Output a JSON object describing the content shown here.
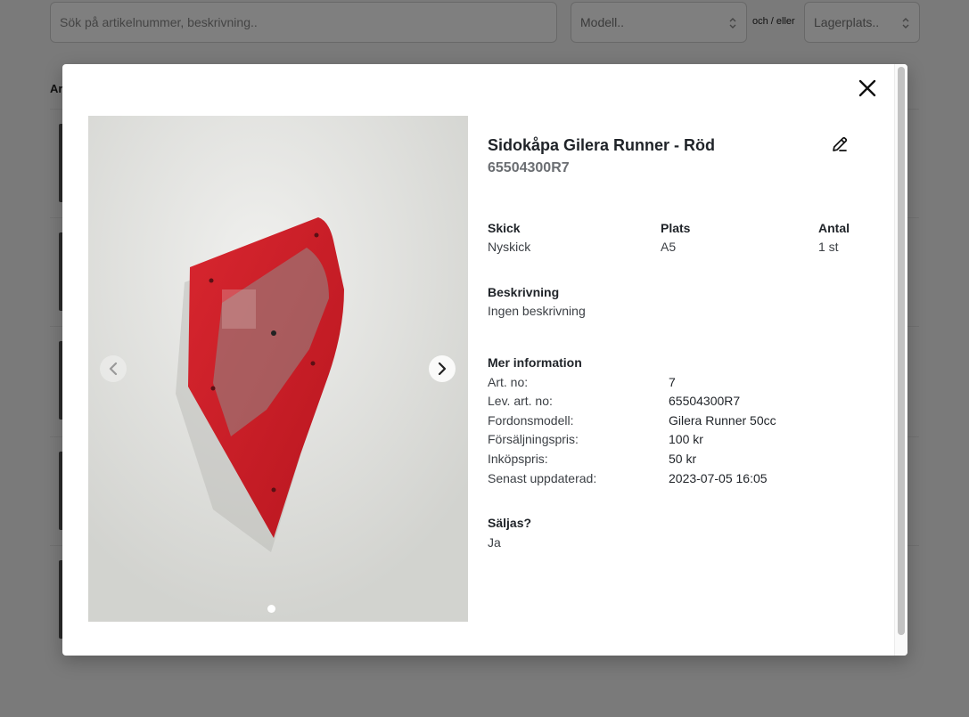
{
  "background": {
    "search": {
      "placeholder": "Sök på artikelnummer, beskrivning.."
    },
    "model_select": {
      "value": "Modell.."
    },
    "and_or": "och / eller",
    "location_select": {
      "value": "Lagerplats.."
    },
    "list_heading": "Ar"
  },
  "modal": {
    "title": "Sidokåpa Gilera Runner - Röd",
    "subtitle": "65504300R7",
    "condition": {
      "label": "Skick",
      "value": "Nyskick"
    },
    "location": {
      "label": "Plats",
      "value": "A5"
    },
    "quantity": {
      "label": "Antal",
      "value": "1 st"
    },
    "description": {
      "label": "Beskrivning",
      "value": "Ingen beskrivning"
    },
    "more_info": {
      "heading": "Mer information",
      "rows": [
        {
          "key": "Art. no:",
          "value": "7"
        },
        {
          "key": "Lev. art. no:",
          "value": "65504300R7"
        },
        {
          "key": "Fordonsmodell:",
          "value": "Gilera Runner 50cc"
        },
        {
          "key": "Försäljningspris:",
          "value": "100 kr"
        },
        {
          "key": "Inköpspris:",
          "value": "50 kr"
        },
        {
          "key": "Senast uppdaterad:",
          "value": "2023-07-05 16:05"
        }
      ]
    },
    "for_sale": {
      "label": "Säljas?",
      "value": "Ja"
    },
    "carousel": {
      "slide_count": 1,
      "active_slide": 1
    }
  },
  "icons": {
    "close": "close-icon",
    "edit": "pencil-edit-icon",
    "prev": "chevron-left-icon",
    "next": "chevron-right-icon",
    "select": "select-arrows-icon"
  },
  "colors": {
    "part_red": "#c8202a",
    "overlay": "#000000"
  }
}
